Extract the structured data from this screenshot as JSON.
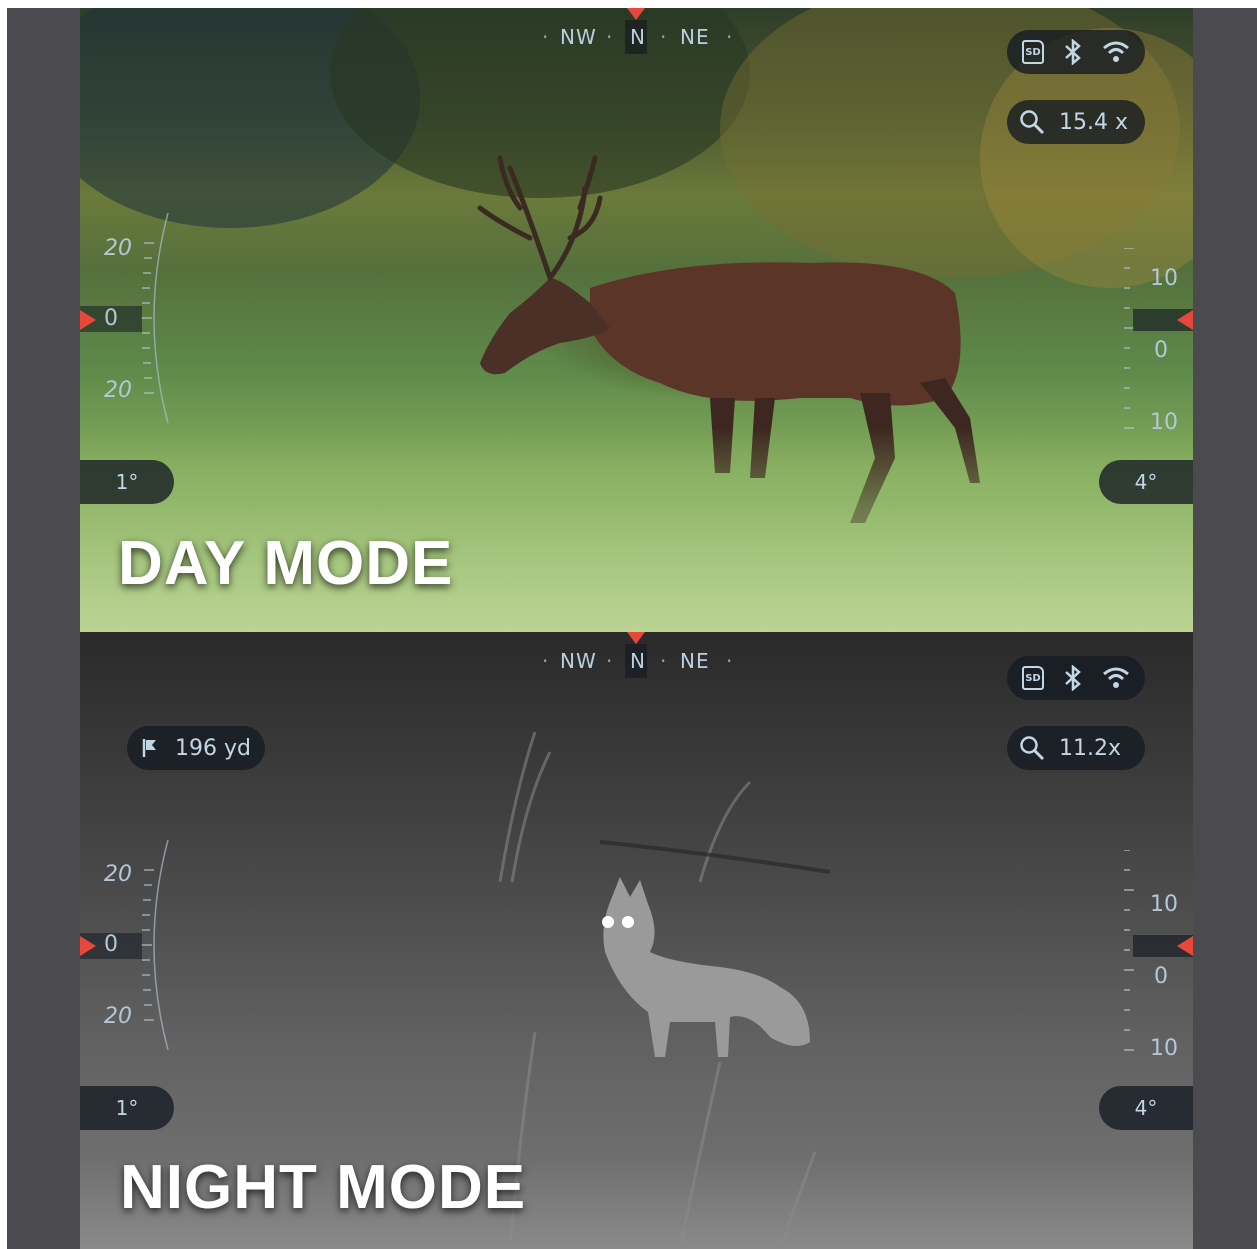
{
  "colors": {
    "frame": "#4a4a4f",
    "accent": "#e8473c",
    "hud_text": "#c3d6e6",
    "pill_bg": "#141a22"
  },
  "icons": {
    "sd": "sd-card-icon",
    "bluetooth": "bluetooth-icon",
    "wifi": "wifi-icon",
    "zoom": "magnifier-icon",
    "range": "flag-icon"
  },
  "day": {
    "title": "DAY MODE",
    "compass": {
      "nw": "NW",
      "n": "N",
      "ne": "NE"
    },
    "status": {
      "sd": "SD"
    },
    "zoom": "15.4 x",
    "left_scale": {
      "top": "20",
      "mid": "0",
      "bottom": "20"
    },
    "right_scale": {
      "top": "10",
      "mid": "0",
      "bottom": "10"
    },
    "angle_left": "1°",
    "angle_right": "4°"
  },
  "night": {
    "title": "NIGHT MODE",
    "compass": {
      "nw": "NW",
      "n": "N",
      "ne": "NE"
    },
    "status": {
      "sd": "SD"
    },
    "range": "196 yd",
    "zoom": "11.2x",
    "left_scale": {
      "top": "20",
      "mid": "0",
      "bottom": "20"
    },
    "right_scale": {
      "top": "10",
      "mid": "0",
      "bottom": "10"
    },
    "angle_left": "1°",
    "angle_right": "4°"
  }
}
